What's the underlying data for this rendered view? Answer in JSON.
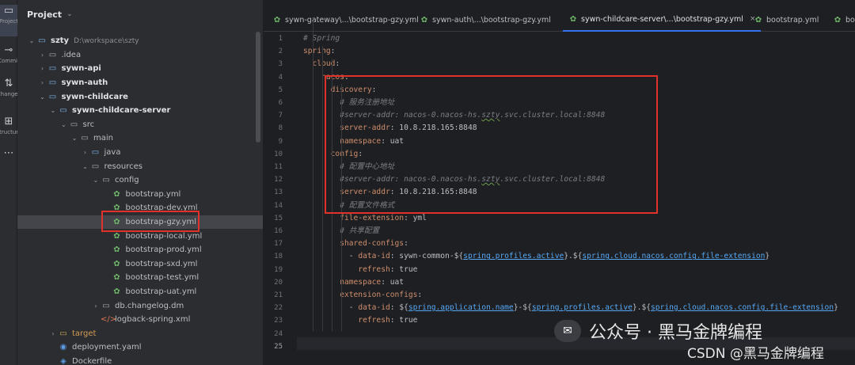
{
  "activity_bar": [
    {
      "label": "Project",
      "glyph": "▭",
      "active": true
    },
    {
      "label": "Commit",
      "glyph": "⊸",
      "active": false
    },
    {
      "label": "Changes",
      "glyph": "⇅",
      "active": false
    },
    {
      "label": "Structure",
      "glyph": "⊞",
      "active": false
    },
    {
      "label": "",
      "glyph": "⋯",
      "active": false
    }
  ],
  "project_panel": {
    "title": "Project",
    "tree": [
      {
        "depth": 0,
        "toggle": "⌄",
        "icon": "▭",
        "icon_kind": "module",
        "label": "szty",
        "bold": true,
        "suffix": "D:\\workspace\\szty"
      },
      {
        "depth": 1,
        "toggle": "›",
        "icon": "▭",
        "icon_kind": "folder",
        "label": ".idea",
        "bold": false,
        "suffix": ""
      },
      {
        "depth": 1,
        "toggle": "›",
        "icon": "▭",
        "icon_kind": "module",
        "label": "sywn-api",
        "bold": true,
        "suffix": ""
      },
      {
        "depth": 1,
        "toggle": "›",
        "icon": "▭",
        "icon_kind": "module",
        "label": "sywn-auth",
        "bold": true,
        "suffix": ""
      },
      {
        "depth": 1,
        "toggle": "⌄",
        "icon": "▭",
        "icon_kind": "module",
        "label": "sywn-childcare",
        "bold": true,
        "suffix": ""
      },
      {
        "depth": 2,
        "toggle": "⌄",
        "icon": "▭",
        "icon_kind": "module",
        "label": "sywn-childcare-server",
        "bold": true,
        "suffix": ""
      },
      {
        "depth": 3,
        "toggle": "⌄",
        "icon": "▭",
        "icon_kind": "folder",
        "label": "src",
        "bold": false,
        "suffix": ""
      },
      {
        "depth": 4,
        "toggle": "⌄",
        "icon": "▭",
        "icon_kind": "folder",
        "label": "main",
        "bold": false,
        "suffix": ""
      },
      {
        "depth": 5,
        "toggle": "›",
        "icon": "▭",
        "icon_kind": "module",
        "label": "java",
        "bold": false,
        "suffix": ""
      },
      {
        "depth": 5,
        "toggle": "⌄",
        "icon": "▭",
        "icon_kind": "folder",
        "label": "resources",
        "bold": false,
        "suffix": ""
      },
      {
        "depth": 6,
        "toggle": "⌄",
        "icon": "▭",
        "icon_kind": "folder",
        "label": "config",
        "bold": false,
        "suffix": ""
      },
      {
        "depth": 7,
        "toggle": "",
        "icon": "✿",
        "icon_kind": "yml",
        "label": "bootstrap.yml",
        "bold": false,
        "suffix": ""
      },
      {
        "depth": 7,
        "toggle": "",
        "icon": "✿",
        "icon_kind": "yml",
        "label": "bootstrap-dev.yml",
        "bold": false,
        "suffix": ""
      },
      {
        "depth": 7,
        "toggle": "",
        "icon": "✿",
        "icon_kind": "yml",
        "label": "bootstrap-gzy.yml",
        "bold": false,
        "suffix": "",
        "selected": true
      },
      {
        "depth": 7,
        "toggle": "",
        "icon": "✿",
        "icon_kind": "yml",
        "label": "bootstrap-local.yml",
        "bold": false,
        "suffix": ""
      },
      {
        "depth": 7,
        "toggle": "",
        "icon": "✿",
        "icon_kind": "yml",
        "label": "bootstrap-prod.yml",
        "bold": false,
        "suffix": ""
      },
      {
        "depth": 7,
        "toggle": "",
        "icon": "✿",
        "icon_kind": "yml",
        "label": "bootstrap-sxd.yml",
        "bold": false,
        "suffix": ""
      },
      {
        "depth": 7,
        "toggle": "",
        "icon": "✿",
        "icon_kind": "yml",
        "label": "bootstrap-test.yml",
        "bold": false,
        "suffix": ""
      },
      {
        "depth": 7,
        "toggle": "",
        "icon": "✿",
        "icon_kind": "yml",
        "label": "bootstrap-uat.yml",
        "bold": false,
        "suffix": ""
      },
      {
        "depth": 6,
        "toggle": "›",
        "icon": "▭",
        "icon_kind": "folder",
        "label": "db.changelog.dm",
        "bold": false,
        "suffix": ""
      },
      {
        "depth": 6,
        "toggle": "",
        "icon": "</>",
        "icon_kind": "xml",
        "label": "logback-spring.xml",
        "bold": false,
        "suffix": ""
      },
      {
        "depth": 2,
        "toggle": "›",
        "icon": "▭",
        "icon_kind": "db",
        "label": "target",
        "bold": false,
        "suffix": "",
        "excluded": true
      },
      {
        "depth": 2,
        "toggle": "",
        "icon": "◉",
        "icon_kind": "docker",
        "label": "deployment.yaml",
        "bold": false,
        "suffix": ""
      },
      {
        "depth": 2,
        "toggle": "",
        "icon": "◈",
        "icon_kind": "docker",
        "label": "Dockerfile",
        "bold": false,
        "suffix": ""
      }
    ]
  },
  "tabs": [
    {
      "label": "sywn-gateway\\...\\bootstrap-gzy.yml",
      "active": false,
      "closable": false
    },
    {
      "label": "sywn-auth\\...\\bootstrap-gzy.yml",
      "active": false,
      "closable": false
    },
    {
      "label": "sywn-childcare-server\\...\\bootstrap-gzy.yml",
      "active": true,
      "closable": true
    },
    {
      "label": "bootstrap.yml",
      "active": false,
      "closable": false
    },
    {
      "label": "bootstrap",
      "active": false,
      "closable": false
    }
  ],
  "tab_close_glyph": "×",
  "editor": {
    "current_line": 25,
    "lines": [
      [
        {
          "t": "# Spring",
          "c": "c"
        }
      ],
      [
        {
          "t": "spring",
          "c": "k"
        },
        {
          "t": ":",
          "c": "v"
        }
      ],
      [
        {
          "t": "  cloud",
          "c": "k"
        },
        {
          "t": ":",
          "c": "v"
        }
      ],
      [
        {
          "t": "    nacos",
          "c": "k"
        },
        {
          "t": ":",
          "c": "v"
        }
      ],
      [
        {
          "t": "      discovery",
          "c": "k"
        },
        {
          "t": ":",
          "c": "v"
        }
      ],
      [
        {
          "t": "        # 服务注册地址",
          "c": "c"
        }
      ],
      [
        {
          "t": "        #server-addr: nacos-0.nacos-hs.",
          "c": "c"
        },
        {
          "t": "szty",
          "c": "c u"
        },
        {
          "t": ".svc.cluster.local:8848",
          "c": "c"
        }
      ],
      [
        {
          "t": "        server-addr",
          "c": "k"
        },
        {
          "t": ": 10.8.218.165:8848",
          "c": "v"
        }
      ],
      [
        {
          "t": "        namespace",
          "c": "k"
        },
        {
          "t": ": uat",
          "c": "v"
        }
      ],
      [
        {
          "t": "      config",
          "c": "k"
        },
        {
          "t": ":",
          "c": "v"
        }
      ],
      [
        {
          "t": "        # 配置中心地址",
          "c": "c"
        }
      ],
      [
        {
          "t": "        #server-addr: nacos-0.nacos-hs.",
          "c": "c"
        },
        {
          "t": "szty",
          "c": "c u"
        },
        {
          "t": ".svc.cluster.local:8848",
          "c": "c"
        }
      ],
      [
        {
          "t": "        server-addr",
          "c": "k"
        },
        {
          "t": ": 10.8.218.165:8848",
          "c": "v"
        }
      ],
      [
        {
          "t": "        # 配置文件格式",
          "c": "c"
        }
      ],
      [
        {
          "t": "        file-extension",
          "c": "k"
        },
        {
          "t": ": yml",
          "c": "v"
        }
      ],
      [
        {
          "t": "        # 共享配置",
          "c": "c"
        }
      ],
      [
        {
          "t": "        shared-configs",
          "c": "k"
        },
        {
          "t": ":",
          "c": "v"
        }
      ],
      [
        {
          "t": "          - ",
          "c": "v"
        },
        {
          "t": "data-id",
          "c": "k"
        },
        {
          "t": ": sywn-common-${",
          "c": "v"
        },
        {
          "t": "spring.profiles.active",
          "c": "ph"
        },
        {
          "t": "}.${",
          "c": "v"
        },
        {
          "t": "spring.cloud.nacos.config.file-extension",
          "c": "ph"
        },
        {
          "t": "}",
          "c": "v"
        }
      ],
      [
        {
          "t": "            refresh",
          "c": "k"
        },
        {
          "t": ": true",
          "c": "v"
        }
      ],
      [
        {
          "t": "        namespace",
          "c": "k"
        },
        {
          "t": ": uat",
          "c": "v"
        }
      ],
      [
        {
          "t": "        extension-configs",
          "c": "k"
        },
        {
          "t": ":",
          "c": "v"
        }
      ],
      [
        {
          "t": "          - ",
          "c": "v"
        },
        {
          "t": "data-id",
          "c": "k"
        },
        {
          "t": ": ${",
          "c": "v"
        },
        {
          "t": "spring.application.name",
          "c": "ph"
        },
        {
          "t": "}-${",
          "c": "v"
        },
        {
          "t": "spring.profiles.active",
          "c": "ph"
        },
        {
          "t": "}.${",
          "c": "v"
        },
        {
          "t": "spring.cloud.nacos.config.file-extension",
          "c": "ph"
        },
        {
          "t": "}",
          "c": "v"
        }
      ],
      [
        {
          "t": "            refresh",
          "c": "k"
        },
        {
          "t": ": true",
          "c": "v"
        }
      ],
      [],
      []
    ]
  },
  "watermark": {
    "logo": "✉",
    "text": "公众号 · 黑马金牌编程",
    "sub": "CSDN @黑马金牌编程"
  },
  "colors": {
    "highlight_box": "#e0312b",
    "active_tab_underline": "#3574f0"
  }
}
